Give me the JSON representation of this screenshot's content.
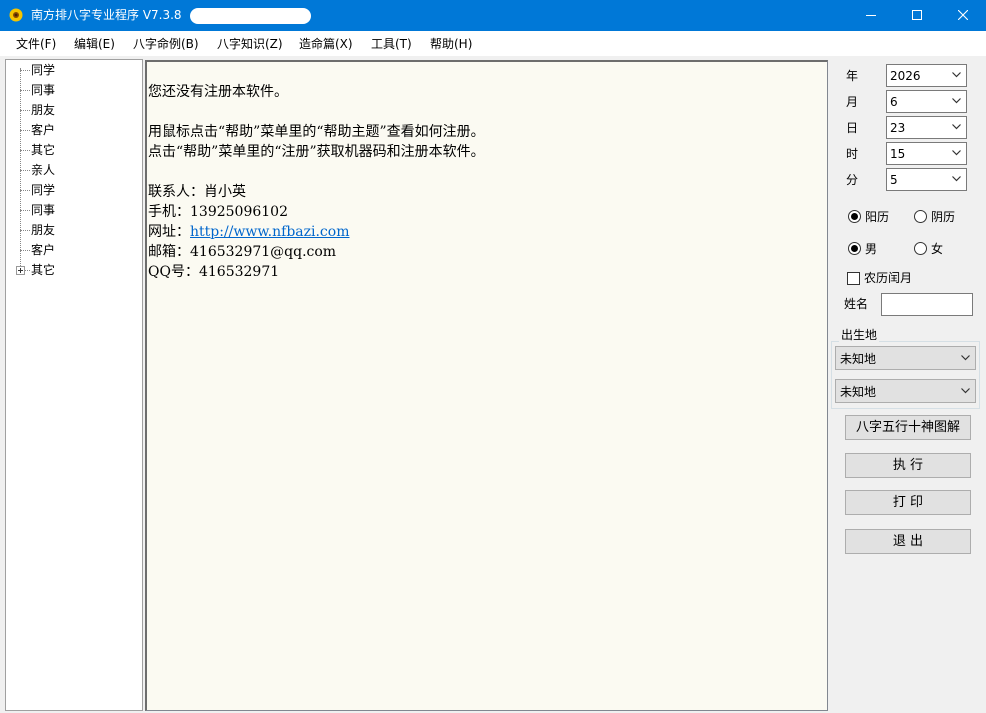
{
  "window": {
    "title": "南方排八字专业程序 V7.3.8",
    "icon": "sunflower-icon",
    "accent_color": "#0078d7"
  },
  "menu": [
    "文件(F)",
    "编辑(E)",
    "八字命例(B)",
    "八字知识(Z)",
    "造命篇(X)",
    "工具(T)",
    "帮助(H)"
  ],
  "tree": {
    "items": [
      "同学",
      "同事",
      "朋友",
      "客户",
      "其它",
      "亲人",
      "同学",
      "同事",
      "朋友",
      "客户",
      "其它"
    ]
  },
  "content": {
    "line1": "您还没有注册本软件。",
    "line2": "用鼠标点击“帮助”菜单里的“帮助主题”查看如何注册。",
    "line3": "点击“帮助”菜单里的“注册”获取机器码和注册本软件。",
    "contact_label": "联系人：",
    "contact_name": "肖小英",
    "phone_label": "手机：",
    "phone": "13925096102",
    "website_label": "网址：",
    "website": "http://www.nfbazi.com",
    "email_label": "邮箱：",
    "email": "416532971@qq.com",
    "qq_label": "QQ号：",
    "qq": "416532971"
  },
  "form": {
    "year_label": "年",
    "year": "2026",
    "month_label": "月",
    "month": "6",
    "day_label": "日",
    "day": "23",
    "hour_label": "时",
    "hour": "15",
    "minute_label": "分",
    "minute": "5",
    "solar_label": "阳历",
    "lunar_label": "阴历",
    "calendar_selected": "阳历",
    "male_label": "男",
    "female_label": "女",
    "gender_selected": "男",
    "leap_month_label": "农历闰月",
    "leap_month_checked": false,
    "name_label": "姓名",
    "name_value": "",
    "birthplace_label": "出生地",
    "province": "未知地",
    "city": "未知地"
  },
  "buttons": {
    "chart": "八字五行十神图解",
    "execute": "执 行",
    "print": "打 印",
    "exit": "退 出"
  }
}
